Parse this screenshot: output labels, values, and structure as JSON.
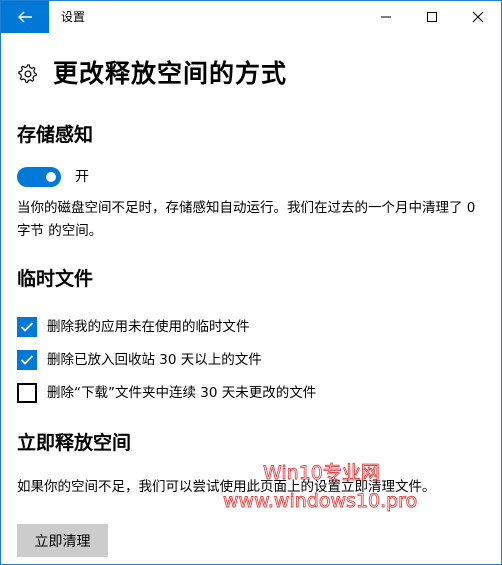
{
  "window": {
    "title": "设置"
  },
  "page": {
    "title": "更改释放空间的方式"
  },
  "storage_sense": {
    "heading": "存储感知",
    "toggle_state": "开",
    "description": "当你的磁盘空间不足时，存储感知自动运行。我们在过去的一个月中清理了 0 字节 的空间。"
  },
  "temp_files": {
    "heading": "临时文件",
    "options": [
      {
        "label": "删除我的应用未在使用的临时文件",
        "checked": true
      },
      {
        "label": "删除已放入回收站 30 天以上的文件",
        "checked": true
      },
      {
        "label": "删除“下载”文件夹中连续 30 天未更改的文件",
        "checked": false
      }
    ]
  },
  "free_space": {
    "heading": "立即释放空间",
    "description": "如果你的空间不足，我们可以尝试使用此页面上的设置立即清理文件。",
    "button_label": "立即清理"
  },
  "watermark": {
    "line1": "Win10专业网",
    "line2": "www.windows10.pro"
  },
  "colors": {
    "accent": "#0078d7",
    "button_bg": "#cccccc",
    "watermark": "#d9292b"
  }
}
